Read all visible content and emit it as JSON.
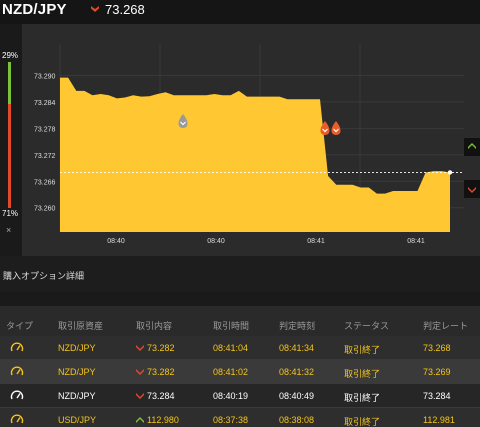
{
  "header": {
    "pair": "NZD/JPY",
    "price": "73.268",
    "price_direction": "down"
  },
  "ratio": {
    "high_pct": "29%",
    "low_pct": "71%",
    "high_value": 29,
    "low_value": 71,
    "close_label": "×"
  },
  "chart_data": {
    "type": "area",
    "y_ticks": [
      "73.290",
      "73.284",
      "73.278",
      "73.272",
      "73.266",
      "73.260"
    ],
    "x_ticks": [
      "08:40",
      "08:40",
      "08:41",
      "08:41"
    ],
    "current_rate": 73.268,
    "fill_color": "#ffc832",
    "ylim": [
      73.2545,
      73.2935
    ],
    "y": [
      73.2895,
      73.2895,
      73.2865,
      73.2865,
      73.2855,
      73.2858,
      73.2855,
      73.2848,
      73.285,
      73.2855,
      73.2852,
      73.2853,
      73.2858,
      73.2862,
      73.2855,
      73.2855,
      73.2855,
      73.2855,
      73.2855,
      73.2858,
      73.2855,
      73.2855,
      73.2865,
      73.2852,
      73.2852,
      73.2852,
      73.2852,
      73.2852,
      73.2846,
      73.2846,
      73.2846,
      73.2846,
      73.2846,
      73.2672,
      73.2652,
      73.2652,
      73.2652,
      73.2646,
      73.2646,
      73.2632,
      73.2632,
      73.2638,
      73.2638,
      73.2638,
      73.2638,
      73.268,
      73.2683,
      73.2683,
      73.268
    ]
  },
  "table": {
    "title": "購入オプション詳細",
    "headers": [
      "タイプ",
      "取引原資産",
      "取引内容",
      "取引時間",
      "判定時刻",
      "ステータス",
      "判定レート"
    ],
    "rows": [
      {
        "asset": "NZD/JPY",
        "direction": "down",
        "rate": "73.282",
        "trade_time": "08:41:04",
        "judge_time": "08:41:34",
        "status": "取引終了",
        "judge_rate": "73.268",
        "style": "yellow"
      },
      {
        "asset": "NZD/JPY",
        "direction": "down",
        "rate": "73.282",
        "trade_time": "08:41:02",
        "judge_time": "08:41:32",
        "status": "取引終了",
        "judge_rate": "73.269",
        "style": "yellow"
      },
      {
        "asset": "NZD/JPY",
        "direction": "down",
        "rate": "73.284",
        "trade_time": "08:40:19",
        "judge_time": "08:40:49",
        "status": "取引終了",
        "judge_rate": "73.284",
        "style": "white"
      },
      {
        "asset": "USD/JPY",
        "direction": "up",
        "rate": "112.980",
        "trade_time": "08:37:38",
        "judge_time": "08:38:08",
        "status": "取引終了",
        "judge_rate": "112.981",
        "style": "yellow"
      }
    ]
  },
  "colors": {
    "up": "#7cc13a",
    "down": "#e04a2a",
    "accent": "#f5c518"
  }
}
